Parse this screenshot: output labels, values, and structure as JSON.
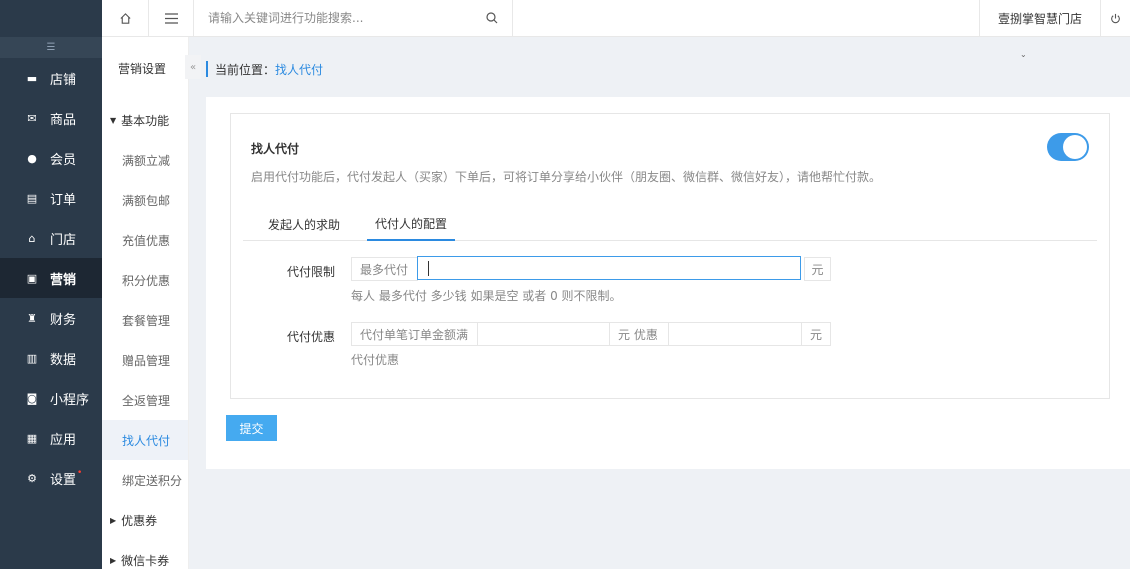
{
  "sidebar": {
    "items": [
      {
        "label": "店铺",
        "icon": "store-icon",
        "glyph": "▬"
      },
      {
        "label": "商品",
        "icon": "goods-icon",
        "glyph": "✉"
      },
      {
        "label": "会员",
        "icon": "member-icon",
        "glyph": "●"
      },
      {
        "label": "订单",
        "icon": "order-icon",
        "glyph": "▤"
      },
      {
        "label": "门店",
        "icon": "shop-icon",
        "glyph": "⌂"
      },
      {
        "label": "营销",
        "icon": "gift-icon",
        "glyph": "▣"
      },
      {
        "label": "财务",
        "icon": "finance-icon",
        "glyph": "♜"
      },
      {
        "label": "数据",
        "icon": "chart-icon",
        "glyph": "▥"
      },
      {
        "label": "小程序",
        "icon": "miniapp-icon",
        "glyph": "◙"
      },
      {
        "label": "应用",
        "icon": "apps-icon",
        "glyph": "▦"
      },
      {
        "label": "设置",
        "icon": "gear-icon",
        "glyph": "⚙"
      }
    ],
    "active_index": 5
  },
  "submenu": {
    "title": "营销设置",
    "group1": "基本功能",
    "items": [
      "满额立减",
      "满额包邮",
      "充值优惠",
      "积分优惠",
      "套餐管理",
      "赠品管理",
      "全返管理",
      "找人代付",
      "绑定送积分"
    ],
    "active_index": 7,
    "group2": "优惠券",
    "group3": "微信卡券"
  },
  "topbar": {
    "search_placeholder": "请输入关键词进行功能搜索...",
    "store_name": "壹捌掌智慧门店"
  },
  "breadcrumb": {
    "prefix": "当前位置：",
    "current": "找人代付"
  },
  "card": {
    "title": "找人代付",
    "description": "启用代付功能后，代付发起人（买家）下单后，可将订单分享给小伙伴（朋友圈、微信群、微信好友），请他帮忙付款。",
    "toggle_on": true,
    "tabs": [
      "发起人的求助",
      "代付人的配置"
    ],
    "active_tab": 1
  },
  "form": {
    "limit": {
      "label": "代付限制",
      "prefix": "最多代付",
      "value": "",
      "suffix": "元",
      "hint": "每人 最多代付 多少钱 如果是空 或者 0 则不限制。"
    },
    "discount": {
      "label": "代付优惠",
      "prefix": "代付单笔订单金额满",
      "value1": "",
      "middle": "元 优惠",
      "value2": "",
      "suffix": "元",
      "hint": "代付优惠"
    }
  },
  "submit_label": "提交",
  "colors": {
    "sidebar_bg": "#2b3a4a",
    "accent": "#2b8ae0",
    "toggle": "#3d9be9",
    "button": "#45aaf0"
  }
}
